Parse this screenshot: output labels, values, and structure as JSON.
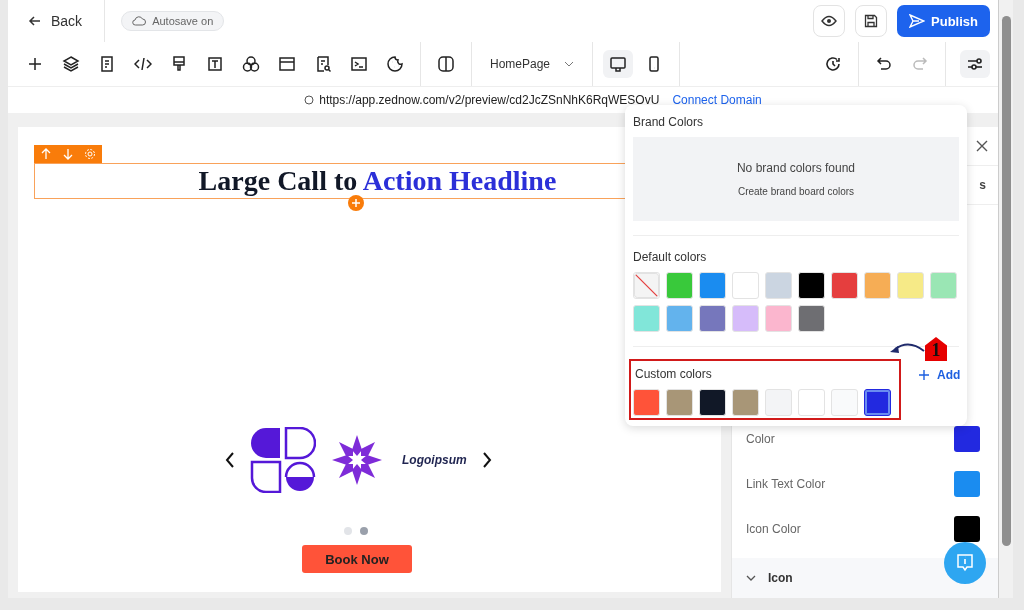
{
  "top_bar": {
    "back": "Back",
    "autosave": "Autosave on",
    "publish": "Publish"
  },
  "toolbar": {
    "page_select": "HomePage",
    "devices": [
      {
        "kind": "desktop",
        "selected": true
      },
      {
        "kind": "mobile",
        "selected": false
      }
    ],
    "undo": {
      "disabled": false
    },
    "redo": {
      "disabled": true
    }
  },
  "url_bar": {
    "url": "https://app.zednow.com/v2/preview/cd2JcZSnNhK6RqWESOvU",
    "link": "Connect Domain"
  },
  "canvas": {
    "headline": "Large Call to",
    "headline_accent": "Action Headline",
    "logo_text": "Logoipsum",
    "dots": [
      {
        "selected": false
      },
      {
        "selected": true
      }
    ],
    "cta": "Book Now"
  },
  "settings_panel": {
    "tab_fragment": "s",
    "rows": [
      {
        "label": "Color",
        "color": "#2229e0"
      },
      {
        "label": "Link Text Color",
        "color": "#1a8cf0"
      },
      {
        "label": "Icon Color",
        "color": "#000000"
      }
    ],
    "section": "Icon"
  },
  "color_picker": {
    "brand_title": "Brand Colors",
    "empty_title": "No brand colors found",
    "empty_link": "Create brand board colors",
    "default_title": "Default colors",
    "default_colors": [
      {
        "kind": "none"
      },
      {
        "kind": "swatch",
        "color": "#39c93b"
      },
      {
        "kind": "swatch",
        "color": "#1a8cf0"
      },
      {
        "kind": "swatch",
        "color": "#ffffff"
      },
      {
        "kind": "swatch",
        "color": "#cbd5e1"
      },
      {
        "kind": "swatch",
        "color": "#000000"
      },
      {
        "kind": "swatch",
        "color": "#e53e3e"
      },
      {
        "kind": "swatch",
        "color": "#f6ad55"
      },
      {
        "kind": "swatch",
        "color": "#f6ea87"
      },
      {
        "kind": "swatch",
        "color": "#9ae6b4"
      },
      {
        "kind": "swatch",
        "color": "#81e6d9"
      },
      {
        "kind": "swatch",
        "color": "#63b3ed"
      },
      {
        "kind": "swatch",
        "color": "#7677bc"
      },
      {
        "kind": "swatch",
        "color": "#d6bcfa"
      },
      {
        "kind": "swatch",
        "color": "#fbb6ce"
      },
      {
        "kind": "swatch",
        "color": "#6e6e72"
      }
    ],
    "custom_title": "Custom colors",
    "add": "Add",
    "custom_colors": [
      {
        "color": "#ff5339",
        "selected": false
      },
      {
        "color": "#a89677",
        "selected": false
      },
      {
        "color": "#111827",
        "selected": false
      },
      {
        "color": "#a89677",
        "selected": false
      },
      {
        "color": "#f3f4f6",
        "selected": false
      },
      {
        "color": "#ffffff",
        "selected": false
      },
      {
        "color": "#f9fafb",
        "selected": false
      },
      {
        "color": "#2229e0",
        "selected": true
      }
    ]
  },
  "annotation": {
    "step": "1"
  }
}
